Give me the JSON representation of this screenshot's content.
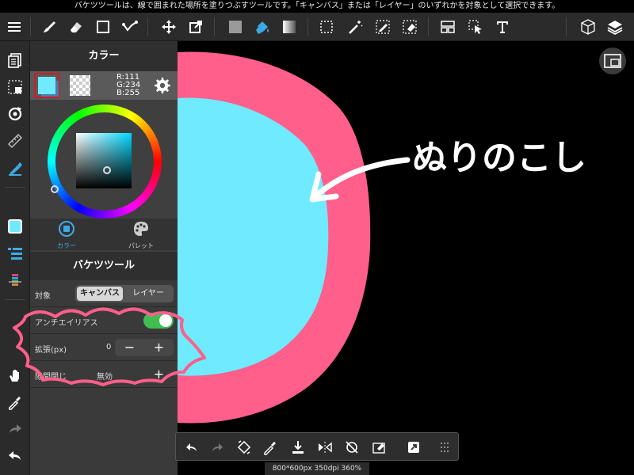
{
  "status_bar": {
    "message": "バケツツールは、線で囲まれた場所を塗りつぶすツールです。「キャンバス」または「レイヤー」のいずれかを対象として選択できます。"
  },
  "toolbar": {
    "tools": [
      "menu-icon",
      "brush-icon",
      "eraser-icon",
      "rectangle-icon",
      "line-icon",
      "move-icon",
      "transform-icon",
      "fill-color-icon",
      "bucket-icon",
      "gradient-icon",
      "select-icon",
      "magic-wand-icon",
      "select-pen-icon",
      "select-eraser-icon",
      "layer-layout-icon",
      "select-arrow-icon",
      "text-icon",
      "3d-object-icon",
      "layers-icon"
    ]
  },
  "color_panel": {
    "title": "カラー",
    "rgb": {
      "r": "R:111",
      "g": "G:234",
      "b": "B:255"
    },
    "main_color": "#6feaff",
    "tabs": [
      {
        "label": "カラー",
        "active": true
      },
      {
        "label": "パレット",
        "active": false
      }
    ]
  },
  "bucket_tool": {
    "title": "バケツツール",
    "target": {
      "label": "対象",
      "options": [
        "キャンバス",
        "レイヤー"
      ],
      "selected": "キャンバス"
    },
    "antialias": {
      "label": "アンチエイリアス",
      "on": true
    },
    "expand": {
      "label": "拡張(px)",
      "value": "0",
      "minus": "−",
      "plus": "+"
    },
    "gap": {
      "label": "隙間閉じ",
      "value": "無効",
      "plus": "+"
    }
  },
  "canvas": {
    "annotation_text": "ぬりのこし",
    "status": "800*600px 350dpi 360%",
    "colors": {
      "fill": "#6feaff",
      "outline": "#ff5f8a",
      "background": "#000000"
    }
  }
}
